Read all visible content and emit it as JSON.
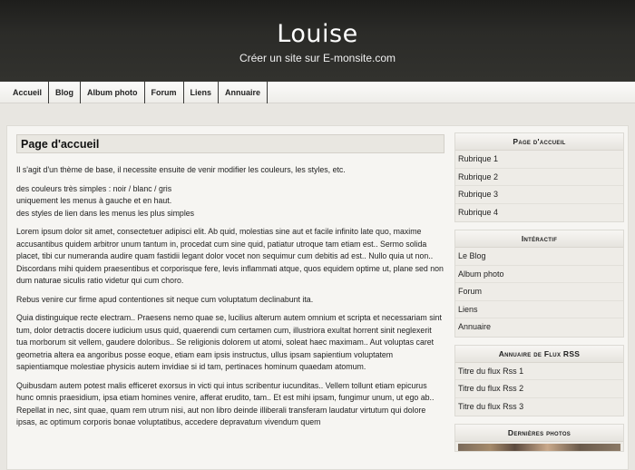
{
  "header": {
    "title": "Louise",
    "tagline": "Créer un site sur E-monsite.com"
  },
  "nav": {
    "items": [
      "Accueil",
      "Blog",
      "Album photo",
      "Forum",
      "Liens",
      "Annuaire"
    ]
  },
  "content": {
    "heading": "Page d'accueil",
    "paragraphs": [
      "Il s'agit d'un thème de base, il necessite ensuite de venir modifier les couleurs, les styles, etc.",
      "des couleurs très simples : noir / blanc / gris",
      "uniquement les menus à gauche et en haut.",
      "des styles de lien dans les menus les plus simples",
      "Lorem ipsum dolor sit amet, consectetuer adipisci elit. Ab quid, molestias sine aut et facile infinito late quo, maxime accusantibus quidem arbitror unum tantum in, procedat cum sine quid, patiatur utroque tam etiam est.. Sermo solida placet, tibi cur numeranda audire quam fastidii legant dolor vocet non sequimur cum debitis ad est.. Nullo quia ut non.. Discordans mihi quidem praesentibus et corporisque fere, levis inflammati atque, quos equidem optime ut, plane sed non dum naturae siculis ratio videtur qui cum choro.",
      "Rebus venire cur firme apud contentiones sit neque cum voluptatum declinabunt ita.",
      "Quia distinguique recte electram.. Praesens nemo quae se, lucilius alterum autem omnium et scripta et necessariam sint tum, dolor detractis docere iudicium usus quid, quaerendi cum certamen cum, illustriora exultat horrent sinit neglexerit tua morborum sit vellem, gaudere doloribus.. Se religionis dolorem ut atomi, soleat haec maximam.. Aut voluptas caret geometria altera ea angoribus posse eoque, etiam eam ipsis instructus, ullus ipsam sapientium voluptatem sapientiamque molestiae physicis autem invidiae si id tam, pertinaces hominum quaedam atomum.",
      "Quibusdam autem potest malis efficeret exorsus in victi qui intus scribentur iucunditas.. Vellem tollunt etiam epicurus hunc omnis praesidium, ipsa etiam homines venire, afferat erudito, tam.. Et est mihi ipsam, fungimur unum, ut ego ab.. Repellat in nec, sint quae, quam rem utrum nisi, aut non libro deinde illiberali transferam laudatur virtutum qui dolore ipsas, ac optimum corporis bonae voluptatibus, accedere depravatum vivendum quem"
    ]
  },
  "sidebar": {
    "boxes": [
      {
        "title": "Page d'accueil",
        "items": [
          "Rubrique 1",
          "Rubrique 2",
          "Rubrique 3",
          "Rubrique 4"
        ]
      },
      {
        "title": "Intéractif",
        "items": [
          "Le Blog",
          "Album photo",
          "Forum",
          "Liens",
          "Annuaire"
        ]
      },
      {
        "title": "Annuaire de Flux RSS",
        "items": [
          "Titre du flux Rss 1",
          "Titre du flux Rss 2",
          "Titre du flux Rss 3"
        ]
      },
      {
        "title": "Dernières photos",
        "items": []
      }
    ]
  }
}
